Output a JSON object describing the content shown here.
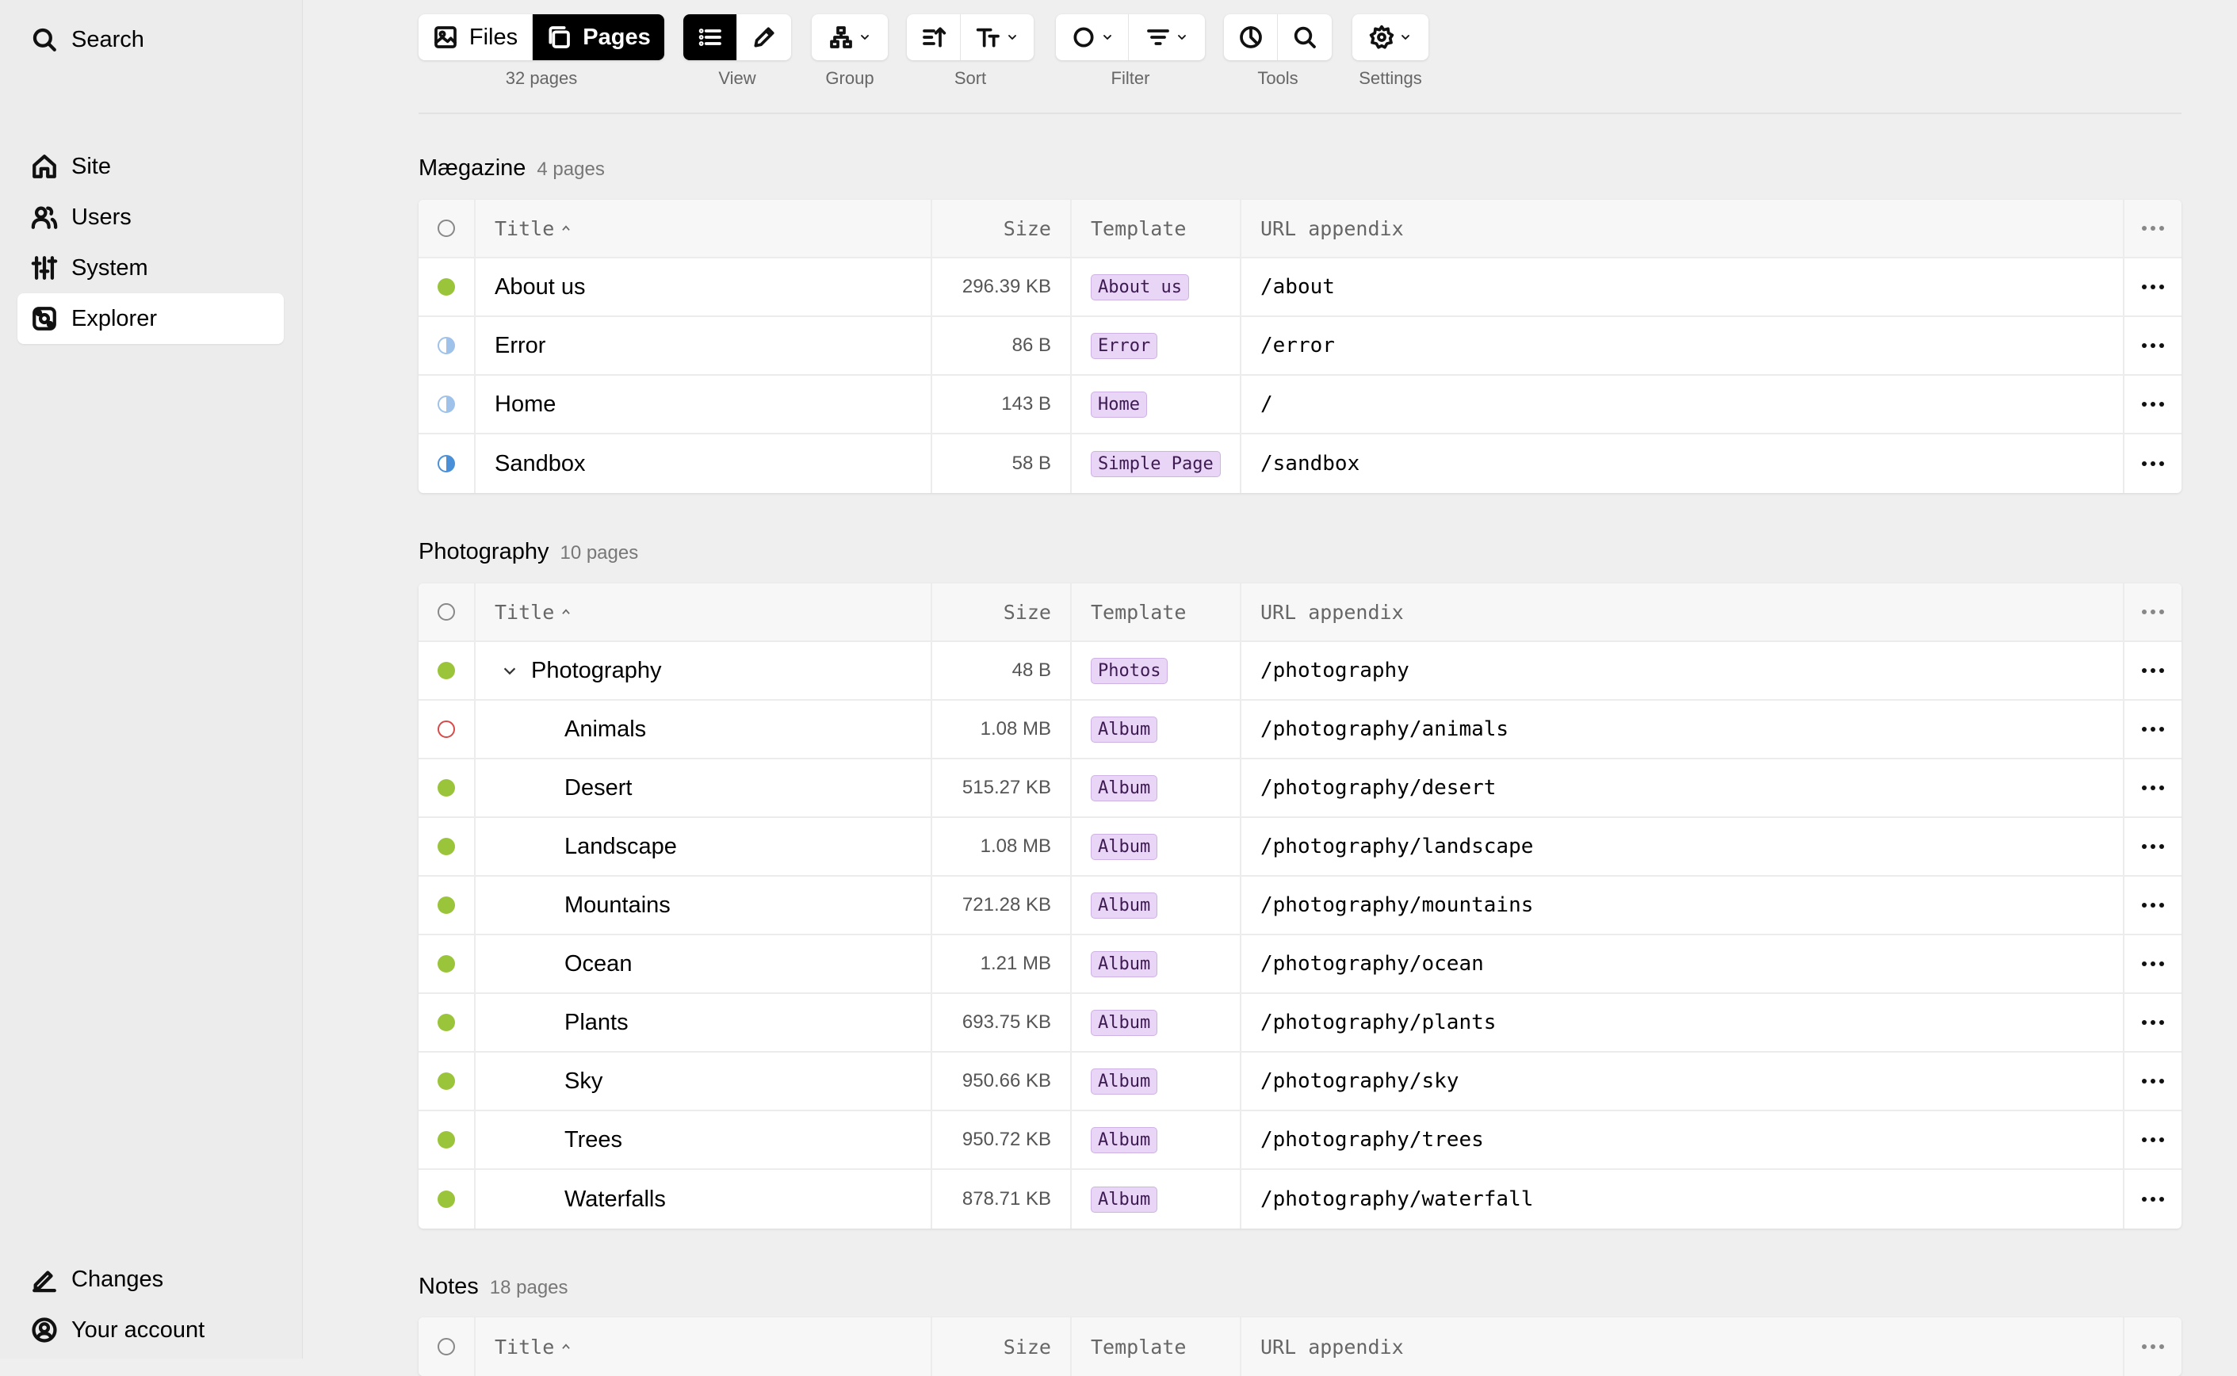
{
  "sidebar": {
    "search": "Search",
    "items": [
      {
        "label": "Site",
        "icon": "home-icon"
      },
      {
        "label": "Users",
        "icon": "users-icon"
      },
      {
        "label": "System",
        "icon": "sliders-icon"
      },
      {
        "label": "Explorer",
        "icon": "explorer-icon",
        "active": true
      }
    ],
    "bottom": [
      {
        "label": "Changes",
        "icon": "pen-icon"
      },
      {
        "label": "Your account",
        "icon": "account-icon"
      }
    ]
  },
  "toolbar": {
    "files": "Files",
    "pages": "Pages",
    "pages_count": "32 pages",
    "view": "View",
    "group": "Group",
    "sort": "Sort",
    "filter": "Filter",
    "tools": "Tools",
    "settings": "Settings"
  },
  "columns": {
    "title": "Title",
    "size": "Size",
    "template": "Template",
    "url": "URL appendix"
  },
  "sections": [
    {
      "name": "Mægazine",
      "count": "4 pages",
      "rows": [
        {
          "status": "listed",
          "title": "About us",
          "size": "296.39 KB",
          "template": "About us",
          "url": "/about"
        },
        {
          "status": "unlisted-light",
          "title": "Error",
          "size": "86 B",
          "template": "Error",
          "url": "/error"
        },
        {
          "status": "unlisted-light",
          "title": "Home",
          "size": "143 B",
          "template": "Home",
          "url": "/"
        },
        {
          "status": "unlisted-dark",
          "title": "Sandbox",
          "size": "58 B",
          "template": "Simple Page",
          "url": "/sandbox"
        }
      ]
    },
    {
      "name": "Photography",
      "count": "10 pages",
      "rows": [
        {
          "status": "listed",
          "title": "Photography",
          "size": "48 B",
          "template": "Photos",
          "url": "/photography",
          "expanded": true
        },
        {
          "status": "draft",
          "title": "Animals",
          "size": "1.08 MB",
          "template": "Album",
          "url": "/photography/animals",
          "child": true
        },
        {
          "status": "listed",
          "title": "Desert",
          "size": "515.27 KB",
          "template": "Album",
          "url": "/photography/desert",
          "child": true
        },
        {
          "status": "listed",
          "title": "Landscape",
          "size": "1.08 MB",
          "template": "Album",
          "url": "/photography/landscape",
          "child": true
        },
        {
          "status": "listed",
          "title": "Mountains",
          "size": "721.28 KB",
          "template": "Album",
          "url": "/photography/mountains",
          "child": true
        },
        {
          "status": "listed",
          "title": "Ocean",
          "size": "1.21 MB",
          "template": "Album",
          "url": "/photography/ocean",
          "child": true
        },
        {
          "status": "listed",
          "title": "Plants",
          "size": "693.75 KB",
          "template": "Album",
          "url": "/photography/plants",
          "child": true
        },
        {
          "status": "listed",
          "title": "Sky",
          "size": "950.66 KB",
          "template": "Album",
          "url": "/photography/sky",
          "child": true
        },
        {
          "status": "listed",
          "title": "Trees",
          "size": "950.72 KB",
          "template": "Album",
          "url": "/photography/trees",
          "child": true
        },
        {
          "status": "listed",
          "title": "Waterfalls",
          "size": "878.71 KB",
          "template": "Album",
          "url": "/photography/waterfall",
          "child": true
        }
      ]
    },
    {
      "name": "Notes",
      "count": "18 pages",
      "rows": []
    }
  ],
  "colors": {
    "listed": "#9ac53b",
    "draft": "#d84a4a",
    "unlisted": "#4a90d9",
    "tag_bg": "#e9d5f5"
  }
}
